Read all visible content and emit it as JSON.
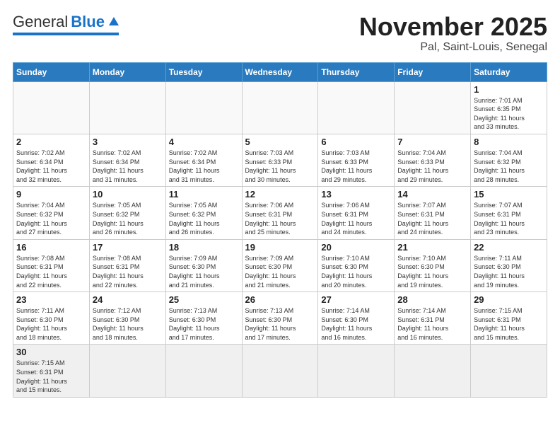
{
  "header": {
    "logo_general": "General",
    "logo_blue": "Blue",
    "month": "November 2025",
    "location": "Pal, Saint-Louis, Senegal"
  },
  "weekdays": [
    "Sunday",
    "Monday",
    "Tuesday",
    "Wednesday",
    "Thursday",
    "Friday",
    "Saturday"
  ],
  "weeks": [
    [
      {
        "day": "",
        "detail": ""
      },
      {
        "day": "",
        "detail": ""
      },
      {
        "day": "",
        "detail": ""
      },
      {
        "day": "",
        "detail": ""
      },
      {
        "day": "",
        "detail": ""
      },
      {
        "day": "",
        "detail": ""
      },
      {
        "day": "1",
        "detail": "Sunrise: 7:01 AM\nSunset: 6:35 PM\nDaylight: 11 hours\nand 33 minutes."
      }
    ],
    [
      {
        "day": "2",
        "detail": "Sunrise: 7:02 AM\nSunset: 6:34 PM\nDaylight: 11 hours\nand 32 minutes."
      },
      {
        "day": "3",
        "detail": "Sunrise: 7:02 AM\nSunset: 6:34 PM\nDaylight: 11 hours\nand 31 minutes."
      },
      {
        "day": "4",
        "detail": "Sunrise: 7:02 AM\nSunset: 6:34 PM\nDaylight: 11 hours\nand 31 minutes."
      },
      {
        "day": "5",
        "detail": "Sunrise: 7:03 AM\nSunset: 6:33 PM\nDaylight: 11 hours\nand 30 minutes."
      },
      {
        "day": "6",
        "detail": "Sunrise: 7:03 AM\nSunset: 6:33 PM\nDaylight: 11 hours\nand 29 minutes."
      },
      {
        "day": "7",
        "detail": "Sunrise: 7:04 AM\nSunset: 6:33 PM\nDaylight: 11 hours\nand 29 minutes."
      },
      {
        "day": "8",
        "detail": "Sunrise: 7:04 AM\nSunset: 6:32 PM\nDaylight: 11 hours\nand 28 minutes."
      }
    ],
    [
      {
        "day": "9",
        "detail": "Sunrise: 7:04 AM\nSunset: 6:32 PM\nDaylight: 11 hours\nand 27 minutes."
      },
      {
        "day": "10",
        "detail": "Sunrise: 7:05 AM\nSunset: 6:32 PM\nDaylight: 11 hours\nand 26 minutes."
      },
      {
        "day": "11",
        "detail": "Sunrise: 7:05 AM\nSunset: 6:32 PM\nDaylight: 11 hours\nand 26 minutes."
      },
      {
        "day": "12",
        "detail": "Sunrise: 7:06 AM\nSunset: 6:31 PM\nDaylight: 11 hours\nand 25 minutes."
      },
      {
        "day": "13",
        "detail": "Sunrise: 7:06 AM\nSunset: 6:31 PM\nDaylight: 11 hours\nand 24 minutes."
      },
      {
        "day": "14",
        "detail": "Sunrise: 7:07 AM\nSunset: 6:31 PM\nDaylight: 11 hours\nand 24 minutes."
      },
      {
        "day": "15",
        "detail": "Sunrise: 7:07 AM\nSunset: 6:31 PM\nDaylight: 11 hours\nand 23 minutes."
      }
    ],
    [
      {
        "day": "16",
        "detail": "Sunrise: 7:08 AM\nSunset: 6:31 PM\nDaylight: 11 hours\nand 22 minutes."
      },
      {
        "day": "17",
        "detail": "Sunrise: 7:08 AM\nSunset: 6:31 PM\nDaylight: 11 hours\nand 22 minutes."
      },
      {
        "day": "18",
        "detail": "Sunrise: 7:09 AM\nSunset: 6:30 PM\nDaylight: 11 hours\nand 21 minutes."
      },
      {
        "day": "19",
        "detail": "Sunrise: 7:09 AM\nSunset: 6:30 PM\nDaylight: 11 hours\nand 21 minutes."
      },
      {
        "day": "20",
        "detail": "Sunrise: 7:10 AM\nSunset: 6:30 PM\nDaylight: 11 hours\nand 20 minutes."
      },
      {
        "day": "21",
        "detail": "Sunrise: 7:10 AM\nSunset: 6:30 PM\nDaylight: 11 hours\nand 19 minutes."
      },
      {
        "day": "22",
        "detail": "Sunrise: 7:11 AM\nSunset: 6:30 PM\nDaylight: 11 hours\nand 19 minutes."
      }
    ],
    [
      {
        "day": "23",
        "detail": "Sunrise: 7:11 AM\nSunset: 6:30 PM\nDaylight: 11 hours\nand 18 minutes."
      },
      {
        "day": "24",
        "detail": "Sunrise: 7:12 AM\nSunset: 6:30 PM\nDaylight: 11 hours\nand 18 minutes."
      },
      {
        "day": "25",
        "detail": "Sunrise: 7:13 AM\nSunset: 6:30 PM\nDaylight: 11 hours\nand 17 minutes."
      },
      {
        "day": "26",
        "detail": "Sunrise: 7:13 AM\nSunset: 6:30 PM\nDaylight: 11 hours\nand 17 minutes."
      },
      {
        "day": "27",
        "detail": "Sunrise: 7:14 AM\nSunset: 6:30 PM\nDaylight: 11 hours\nand 16 minutes."
      },
      {
        "day": "28",
        "detail": "Sunrise: 7:14 AM\nSunset: 6:31 PM\nDaylight: 11 hours\nand 16 minutes."
      },
      {
        "day": "29",
        "detail": "Sunrise: 7:15 AM\nSunset: 6:31 PM\nDaylight: 11 hours\nand 15 minutes."
      }
    ],
    [
      {
        "day": "30",
        "detail": "Sunrise: 7:15 AM\nSunset: 6:31 PM\nDaylight: 11 hours\nand 15 minutes."
      },
      {
        "day": "",
        "detail": ""
      },
      {
        "day": "",
        "detail": ""
      },
      {
        "day": "",
        "detail": ""
      },
      {
        "day": "",
        "detail": ""
      },
      {
        "day": "",
        "detail": ""
      },
      {
        "day": "",
        "detail": ""
      }
    ]
  ]
}
